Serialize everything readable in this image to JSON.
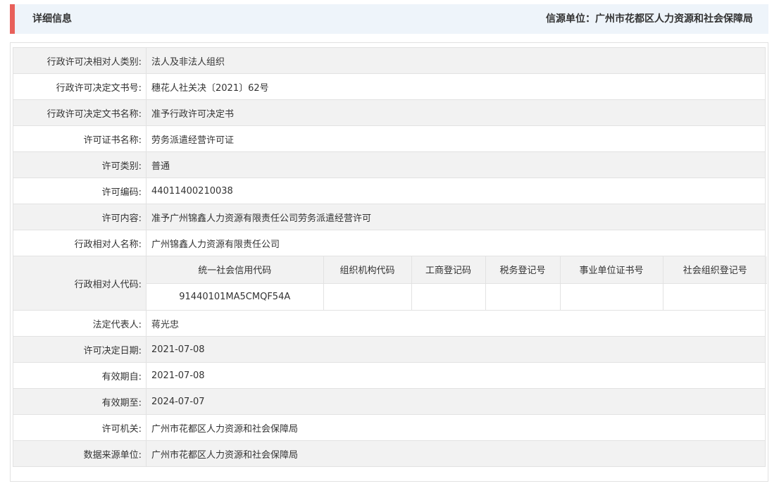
{
  "header": {
    "title": "详细信息",
    "source_label": "信源单位：",
    "source_value": "广州市花都区人力资源和社会保障局",
    "accent_color": "#e8605a"
  },
  "rows_before": [
    {
      "label": "行政许可决相对人类别:",
      "value": "法人及非法人组织"
    },
    {
      "label": "行政许可决定文书号:",
      "value": "穗花人社关决〔2021〕62号"
    },
    {
      "label": "行政许可决定文书名称:",
      "value": "准予行政许可决定书"
    },
    {
      "label": "许可证书名称:",
      "value": "劳务派遣经营许可证"
    },
    {
      "label": "许可类别:",
      "value": "普通"
    },
    {
      "label": "许可编码:",
      "value": "44011400210038"
    },
    {
      "label": "许可内容:",
      "value": "准予广州锦鑫人力资源有限责任公司劳务派遣经营许可"
    },
    {
      "label": "行政相对人名称:",
      "value": "广州锦鑫人力资源有限责任公司"
    }
  ],
  "code_row": {
    "label": "行政相对人代码:",
    "headers": [
      "统一社会信用代码",
      "组织机构代码",
      "工商登记码",
      "税务登记号",
      "事业单位证书号",
      "社会组织登记号"
    ],
    "values": [
      "91440101MA5CMQF54A",
      "",
      "",
      "",
      "",
      ""
    ]
  },
  "rows_after": [
    {
      "label": "法定代表人:",
      "value": "蒋光忠"
    },
    {
      "label": "许可决定日期:",
      "value": "2021-07-08"
    },
    {
      "label": "有效期自:",
      "value": "2021-07-08"
    },
    {
      "label": "有效期至:",
      "value": "2024-07-07"
    },
    {
      "label": "许可机关:",
      "value": "广州市花都区人力资源和社会保障局"
    },
    {
      "label": "数据来源单位:",
      "value": "广州市花都区人力资源和社会保障局"
    }
  ]
}
